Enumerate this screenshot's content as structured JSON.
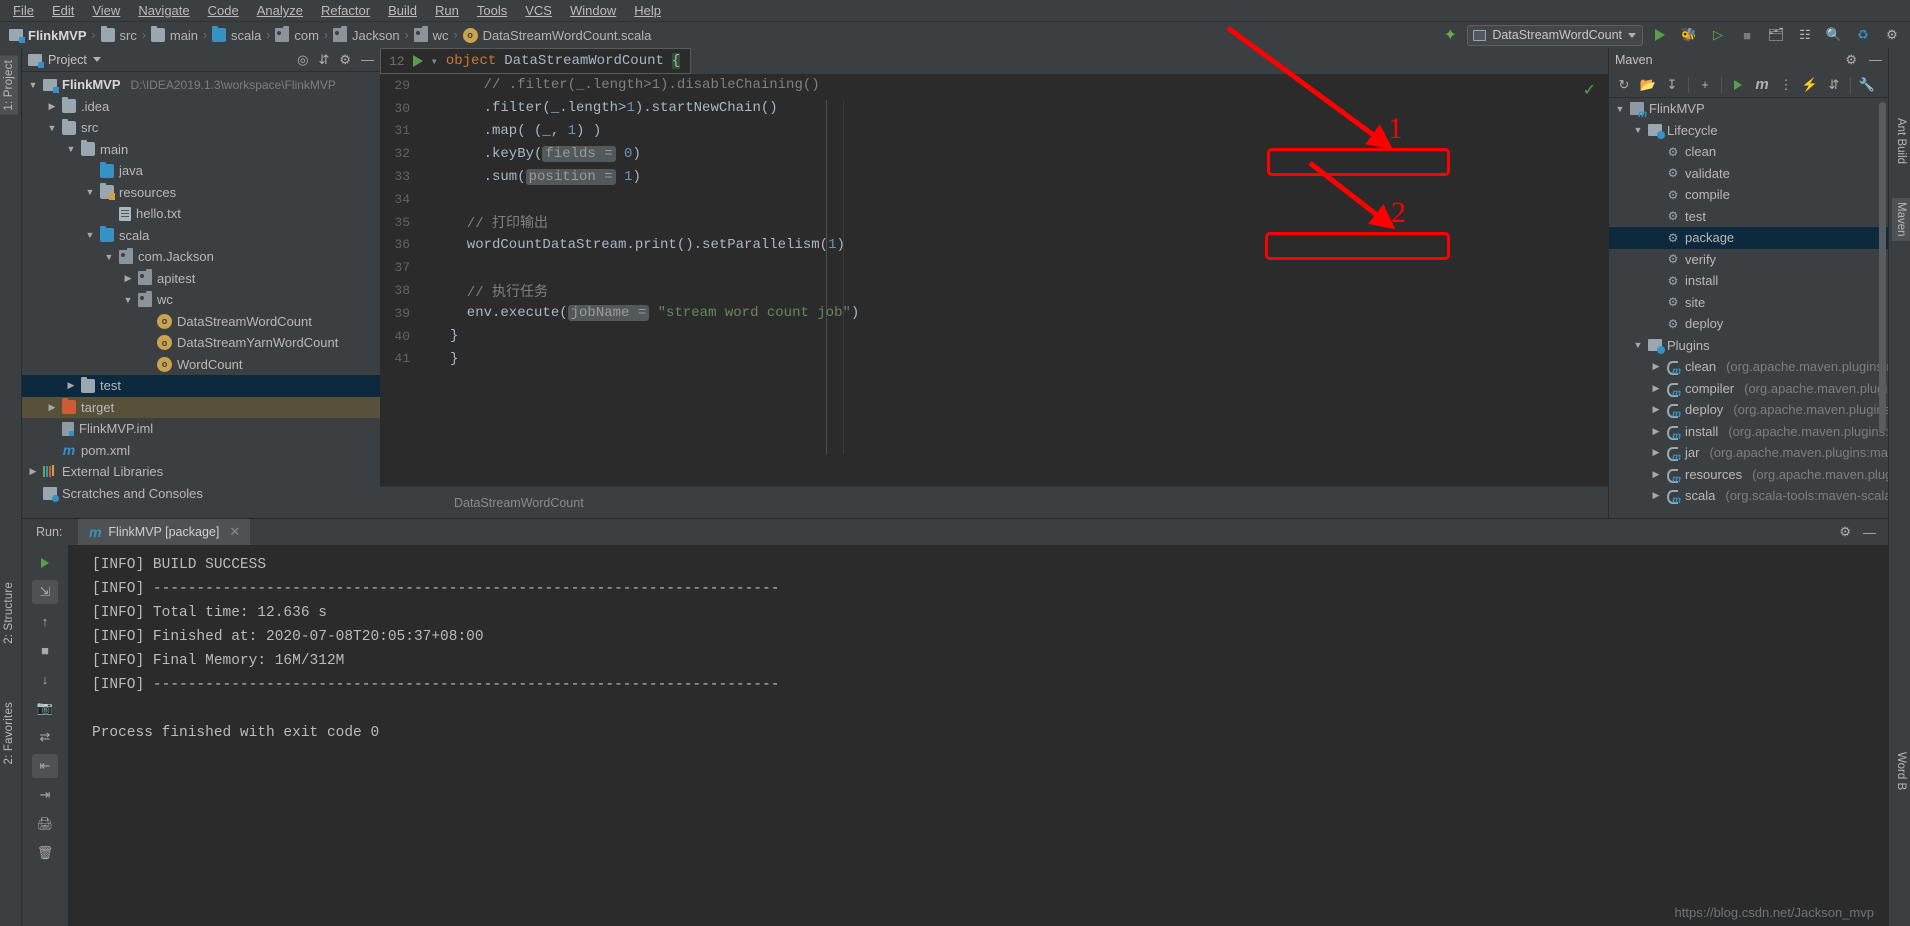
{
  "menu": {
    "items": [
      "File",
      "Edit",
      "View",
      "Navigate",
      "Code",
      "Analyze",
      "Refactor",
      "Build",
      "Run",
      "Tools",
      "VCS",
      "Window",
      "Help"
    ]
  },
  "breadcrumb": {
    "items": [
      {
        "label": "FlinkMVP",
        "icon": "project-icon"
      },
      {
        "label": "src",
        "icon": "folder-icon"
      },
      {
        "label": "main",
        "icon": "folder-icon"
      },
      {
        "label": "scala",
        "icon": "source-folder-icon"
      },
      {
        "label": "com",
        "icon": "package-icon"
      },
      {
        "label": "Jackson",
        "icon": "package-icon"
      },
      {
        "label": "wc",
        "icon": "package-icon"
      },
      {
        "label": "DataStreamWordCount.scala",
        "icon": "scala-object-icon"
      }
    ],
    "separator": "›"
  },
  "toolbar": {
    "run_config": "DataStreamWordCount",
    "build_icon": "hammer-icon",
    "run_icon": "run-icon",
    "debug_icon": "debug-icon",
    "run_coverage_icon": "run-coverage-icon",
    "stop_icon": "stop-icon",
    "project_structure_icon": "project-structure-icon",
    "layout_icon": "layout-icon",
    "search_icon": "search-icon",
    "update_icon": "update-icon",
    "settings_icon": "settings-icon"
  },
  "left_strip": {
    "tabs": [
      {
        "label": "1: Project",
        "selected": true
      },
      {
        "label": "2: Structure",
        "selected": false
      },
      {
        "label": "2: Favorites",
        "selected": false
      }
    ]
  },
  "right_strip": {
    "tabs": [
      {
        "label": "Ant Build",
        "selected": false
      },
      {
        "label": "Maven",
        "selected": true
      },
      {
        "label": "Word B",
        "selected": false
      }
    ]
  },
  "project_panel": {
    "title": "Project",
    "dropdown_icon": "chevron-down-icon",
    "locate_icon": "locate-icon",
    "collapse_icon": "collapse-all-icon",
    "settings_icon": "gear-icon",
    "hide_icon": "hide-icon",
    "tree": [
      {
        "indent": 0,
        "arrow": "▼",
        "icon": "project-icon",
        "label": "FlinkMVP",
        "bold": true,
        "path": "D:\\IDEA2019.1.3\\workspace\\FlinkMVP",
        "state": "none"
      },
      {
        "indent": 1,
        "arrow": "▶",
        "icon": "folder-icon",
        "label": ".idea",
        "bold": false,
        "path": "",
        "state": "none"
      },
      {
        "indent": 1,
        "arrow": "▼",
        "icon": "folder-icon",
        "label": "src",
        "bold": false,
        "path": "",
        "state": "none"
      },
      {
        "indent": 2,
        "arrow": "▼",
        "icon": "folder-icon",
        "label": "main",
        "bold": false,
        "path": "",
        "state": "none"
      },
      {
        "indent": 3,
        "arrow": "",
        "icon": "source-folder-icon",
        "label": "java",
        "bold": false,
        "path": "",
        "state": "none"
      },
      {
        "indent": 3,
        "arrow": "▼",
        "icon": "resources-folder-icon",
        "label": "resources",
        "bold": false,
        "path": "",
        "state": "none"
      },
      {
        "indent": 4,
        "arrow": "",
        "icon": "text-file-icon",
        "label": "hello.txt",
        "bold": false,
        "path": "",
        "state": "none"
      },
      {
        "indent": 3,
        "arrow": "▼",
        "icon": "source-folder-icon",
        "label": "scala",
        "bold": false,
        "path": "",
        "state": "none"
      },
      {
        "indent": 4,
        "arrow": "▼",
        "icon": "package-icon",
        "label": "com.Jackson",
        "bold": false,
        "path": "",
        "state": "none"
      },
      {
        "indent": 5,
        "arrow": "▶",
        "icon": "package-icon",
        "label": "apitest",
        "bold": false,
        "path": "",
        "state": "none"
      },
      {
        "indent": 5,
        "arrow": "▼",
        "icon": "package-icon",
        "label": "wc",
        "bold": false,
        "path": "",
        "state": "none"
      },
      {
        "indent": 6,
        "arrow": "",
        "icon": "scala-object-icon",
        "label": "DataStreamWordCount",
        "bold": false,
        "path": "",
        "state": "none"
      },
      {
        "indent": 6,
        "arrow": "",
        "icon": "scala-object-icon",
        "label": "DataStreamYarnWordCount",
        "bold": false,
        "path": "",
        "state": "none"
      },
      {
        "indent": 6,
        "arrow": "",
        "icon": "scala-object-icon",
        "label": "WordCount",
        "bold": false,
        "path": "",
        "state": "none"
      },
      {
        "indent": 2,
        "arrow": "▶",
        "icon": "folder-icon",
        "label": "test",
        "bold": false,
        "path": "",
        "state": "selected"
      },
      {
        "indent": 1,
        "arrow": "▶",
        "icon": "target-folder-icon",
        "label": "target",
        "bold": false,
        "path": "",
        "state": "highlighted"
      },
      {
        "indent": 1,
        "arrow": "",
        "icon": "iml-file-icon",
        "label": "FlinkMVP.iml",
        "bold": false,
        "path": "",
        "state": "none"
      },
      {
        "indent": 1,
        "arrow": "",
        "icon": "maven-file-icon",
        "label": "pom.xml",
        "bold": false,
        "path": "",
        "state": "none"
      },
      {
        "indent": 0,
        "arrow": "▶",
        "icon": "libraries-icon",
        "label": "External Libraries",
        "bold": false,
        "path": "",
        "state": "none"
      },
      {
        "indent": 0,
        "arrow": "",
        "icon": "scratches-icon",
        "label": "Scratches and Consoles",
        "bold": false,
        "path": "",
        "state": "none"
      }
    ]
  },
  "editor": {
    "sticky_header": {
      "line": "12",
      "run_icon": "run-gutter-icon",
      "text_keyword": "object",
      "text_name": "DataStreamWordCount",
      "brace": "{"
    },
    "status_text": "DataStreamWordCount",
    "inspection_icon": "inspection-ok-icon",
    "lines": [
      {
        "num": "29",
        "segments": [
          {
            "t": "    // .filter(_.length>1).disableChaining()",
            "c": "cm"
          }
        ]
      },
      {
        "num": "30",
        "segments": [
          {
            "t": "    .filter(_.length>",
            "c": "id"
          },
          {
            "t": "1",
            "c": "n"
          },
          {
            "t": ").startNewChain()",
            "c": "id"
          }
        ]
      },
      {
        "num": "31",
        "segments": [
          {
            "t": "    .map( (_, ",
            "c": "id"
          },
          {
            "t": "1",
            "c": "n"
          },
          {
            "t": ") )",
            "c": "id"
          }
        ]
      },
      {
        "num": "32",
        "segments": [
          {
            "t": "    .keyBy(",
            "c": "id"
          },
          {
            "t": "fields =",
            "c": "hint"
          },
          {
            "t": " ",
            "c": "id"
          },
          {
            "t": "0",
            "c": "n"
          },
          {
            "t": ")",
            "c": "id"
          }
        ]
      },
      {
        "num": "33",
        "segments": [
          {
            "t": "    .sum(",
            "c": "id"
          },
          {
            "t": "position =",
            "c": "hint"
          },
          {
            "t": " ",
            "c": "id"
          },
          {
            "t": "1",
            "c": "n"
          },
          {
            "t": ")",
            "c": "id"
          }
        ]
      },
      {
        "num": "34",
        "segments": [
          {
            "t": "",
            "c": "id"
          }
        ]
      },
      {
        "num": "35",
        "segments": [
          {
            "t": "  // 打印输出",
            "c": "cm"
          }
        ]
      },
      {
        "num": "36",
        "segments": [
          {
            "t": "  wordCountDataStream.print().setParallelism(",
            "c": "id"
          },
          {
            "t": "1",
            "c": "n"
          },
          {
            "t": ")",
            "c": "id"
          }
        ]
      },
      {
        "num": "37",
        "segments": [
          {
            "t": "",
            "c": "id"
          }
        ]
      },
      {
        "num": "38",
        "segments": [
          {
            "t": "  // 执行任务",
            "c": "cm"
          }
        ]
      },
      {
        "num": "39",
        "segments": [
          {
            "t": "  env.execute(",
            "c": "id"
          },
          {
            "t": "jobName =",
            "c": "hint"
          },
          {
            "t": " ",
            "c": "id"
          },
          {
            "t": "\"stream word count job\"",
            "c": "s"
          },
          {
            "t": ")",
            "c": "id"
          }
        ]
      },
      {
        "num": "40",
        "segments": [
          {
            "t": "}",
            "c": "id"
          }
        ]
      },
      {
        "num": "41",
        "segments": [
          {
            "t": "}",
            "c": "id"
          }
        ]
      }
    ]
  },
  "maven": {
    "title": "Maven",
    "settings_icon": "gear-icon",
    "hide_icon": "hide-icon",
    "toolbar_icons": [
      "reimport-icon",
      "generate-sources-icon",
      "download-sources-icon",
      "add-maven-project-icon",
      "execute-goal-icon",
      "maven-settings-icon",
      "toggle-offline-icon",
      "toggle-skip-tests-icon",
      "collapse-all-icon",
      "maven-wrench-icon"
    ],
    "tree": [
      {
        "indent": 0,
        "arrow": "▼",
        "icon": "maven-project-icon",
        "label": "FlinkMVP",
        "detail": "",
        "state": "none"
      },
      {
        "indent": 1,
        "arrow": "▼",
        "icon": "lifecycle-folder-icon",
        "label": "Lifecycle",
        "detail": "",
        "state": "none"
      },
      {
        "indent": 2,
        "arrow": "",
        "icon": "goal-icon",
        "label": "clean",
        "detail": "",
        "state": "none"
      },
      {
        "indent": 2,
        "arrow": "",
        "icon": "goal-icon",
        "label": "validate",
        "detail": "",
        "state": "none"
      },
      {
        "indent": 2,
        "arrow": "",
        "icon": "goal-icon",
        "label": "compile",
        "detail": "",
        "state": "none"
      },
      {
        "indent": 2,
        "arrow": "",
        "icon": "goal-icon",
        "label": "test",
        "detail": "",
        "state": "none"
      },
      {
        "indent": 2,
        "arrow": "",
        "icon": "goal-icon",
        "label": "package",
        "detail": "",
        "state": "selected"
      },
      {
        "indent": 2,
        "arrow": "",
        "icon": "goal-icon",
        "label": "verify",
        "detail": "",
        "state": "none"
      },
      {
        "indent": 2,
        "arrow": "",
        "icon": "goal-icon",
        "label": "install",
        "detail": "",
        "state": "none"
      },
      {
        "indent": 2,
        "arrow": "",
        "icon": "goal-icon",
        "label": "site",
        "detail": "",
        "state": "none"
      },
      {
        "indent": 2,
        "arrow": "",
        "icon": "goal-icon",
        "label": "deploy",
        "detail": "",
        "state": "none"
      },
      {
        "indent": 1,
        "arrow": "▼",
        "icon": "plugins-folder-icon",
        "label": "Plugins",
        "detail": "",
        "state": "none"
      },
      {
        "indent": 2,
        "arrow": "▶",
        "icon": "plugin-icon",
        "label": "clean",
        "detail": "(org.apache.maven.plugins:ma",
        "state": "none"
      },
      {
        "indent": 2,
        "arrow": "▶",
        "icon": "plugin-icon",
        "label": "compiler",
        "detail": "(org.apache.maven.plugins",
        "state": "none"
      },
      {
        "indent": 2,
        "arrow": "▶",
        "icon": "plugin-icon",
        "label": "deploy",
        "detail": "(org.apache.maven.plugins:m",
        "state": "none"
      },
      {
        "indent": 2,
        "arrow": "▶",
        "icon": "plugin-icon",
        "label": "install",
        "detail": "(org.apache.maven.plugins:ma",
        "state": "none"
      },
      {
        "indent": 2,
        "arrow": "▶",
        "icon": "plugin-icon",
        "label": "jar",
        "detail": "(org.apache.maven.plugins:maven",
        "state": "none"
      },
      {
        "indent": 2,
        "arrow": "▶",
        "icon": "plugin-icon",
        "label": "resources",
        "detail": "(org.apache.maven.plugins",
        "state": "none"
      },
      {
        "indent": 2,
        "arrow": "▶",
        "icon": "plugin-icon",
        "label": "scala",
        "detail": "(org.scala-tools:maven-scala-pl",
        "state": "none"
      }
    ]
  },
  "run_panel": {
    "label": "Run:",
    "tab_label": "FlinkMVP [package]",
    "tab_icon": "maven-m-icon",
    "close_icon": "close-icon",
    "settings_icon": "gear-icon",
    "hide_icon": "hide-icon",
    "side_icons": [
      "rerun-icon",
      "collapse-icon",
      "scroll-up-icon",
      "stop-icon",
      "scroll-down-icon",
      "camera-icon",
      "wrap-icon",
      "print-icon",
      "trash-icon"
    ],
    "console_lines": [
      "[INFO] BUILD SUCCESS",
      "[INFO] ------------------------------------------------------------------------",
      "[INFO] Total time: 12.636 s",
      "[INFO] Finished at: 2020-07-08T20:05:37+08:00",
      "[INFO] Final Memory: 16M/312M",
      "[INFO] ------------------------------------------------------------------------",
      "",
      "Process finished with exit code 0"
    ],
    "watermark": "https://blog.csdn.net/Jackson_mvp"
  },
  "annotations": {
    "color": "#ff0000",
    "markers": [
      {
        "number": "1",
        "target": "clean"
      },
      {
        "number": "2",
        "target": "package"
      }
    ]
  }
}
